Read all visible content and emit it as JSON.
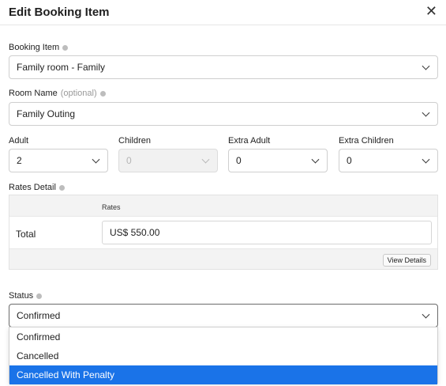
{
  "modal": {
    "title": "Edit Booking Item"
  },
  "booking_item": {
    "label": "Booking Item",
    "value": "Family room - Family"
  },
  "room_name": {
    "label": "Room Name",
    "optional": "(optional)",
    "value": "Family Outing"
  },
  "occupancy": {
    "adult": {
      "label": "Adult",
      "value": "2"
    },
    "children": {
      "label": "Children",
      "value": "0"
    },
    "extra_adult": {
      "label": "Extra Adult",
      "value": "0"
    },
    "extra_children": {
      "label": "Extra Children",
      "value": "0"
    }
  },
  "rates": {
    "label": "Rates Detail",
    "column": "Rates",
    "row_label": "Total",
    "value": "US$ 550.00",
    "view_details": "View Details"
  },
  "status": {
    "label": "Status",
    "value": "Confirmed",
    "options": [
      "Confirmed",
      "Cancelled",
      "Cancelled With Penalty"
    ],
    "highlighted": "Cancelled With Penalty"
  },
  "colors": {
    "highlight": "#1a73e8"
  }
}
